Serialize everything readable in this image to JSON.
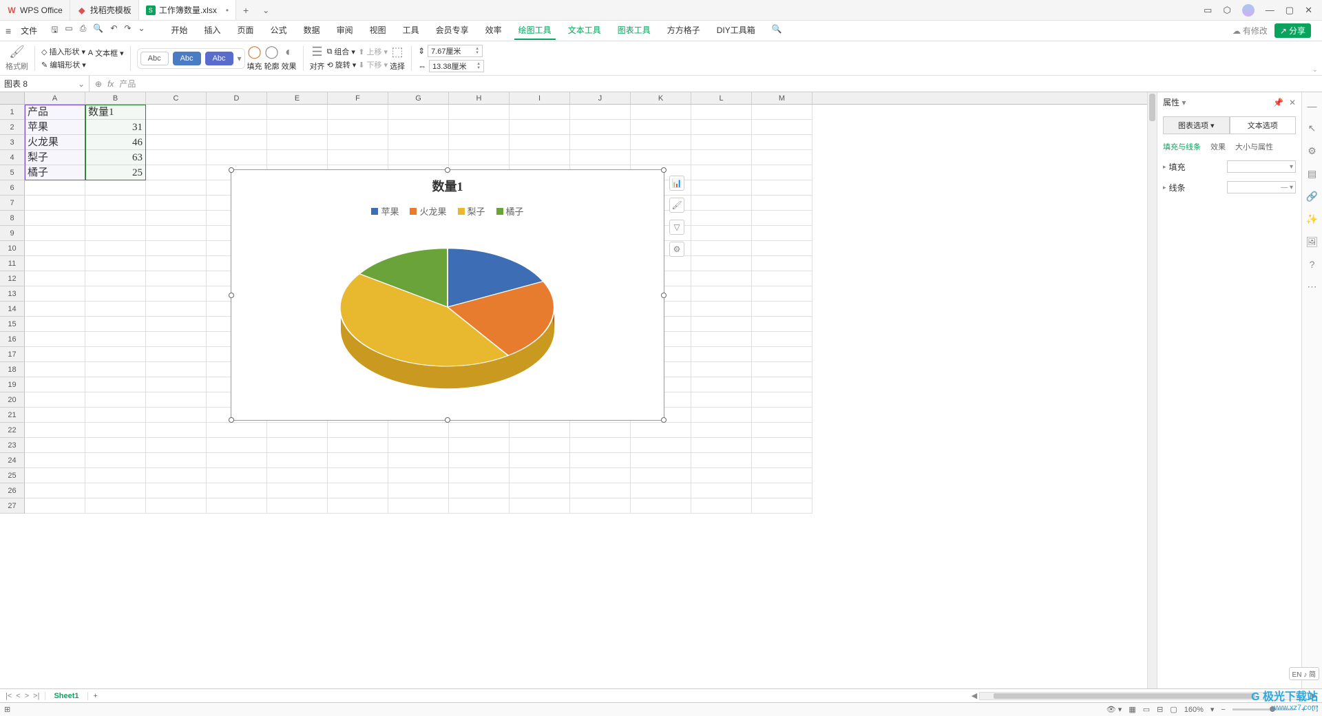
{
  "title_tabs": [
    {
      "icon": "W",
      "label": "WPS Office",
      "active": false
    },
    {
      "icon": "D",
      "label": "找稻壳模板",
      "active": false
    },
    {
      "icon": "S",
      "label": "工作簿数量.xlsx",
      "active": true,
      "dirty": "•"
    }
  ],
  "file_menu": "文件",
  "menu_tabs": [
    "开始",
    "插入",
    "页面",
    "公式",
    "数据",
    "审阅",
    "视图",
    "工具",
    "会员专享",
    "效率"
  ],
  "menu_tabs_green": [
    "绘图工具",
    "文本工具",
    "图表工具",
    "方方格子",
    "DIY工具箱"
  ],
  "menu_active": "绘图工具",
  "modify_label": "有修改",
  "share_label": "分享",
  "ribbon": {
    "format_painter": "格式刷",
    "insert_shape": "插入形状",
    "text_box": "文本框",
    "edit_shape": "编辑形状",
    "abc1": "Abc",
    "abc2": "Abc",
    "abc3": "Abc",
    "fill": "填充",
    "outline": "轮廓",
    "effect": "效果",
    "align": "对齐",
    "group": "组合",
    "rotate": "旋转",
    "up": "上移",
    "down": "下移",
    "select": "选择",
    "w_label": "7.67厘米",
    "h_label": "13.38厘米"
  },
  "name_box": "图表 8",
  "formula": "产品",
  "columns": [
    "A",
    "B",
    "C",
    "D",
    "E",
    "F",
    "G",
    "H",
    "I",
    "J",
    "K",
    "L",
    "M"
  ],
  "row_count": 27,
  "cells": {
    "A1": "产品",
    "B1": "数量1",
    "A2": "苹果",
    "B2": "31",
    "A3": "火龙果",
    "B3": "46",
    "A4": "梨子",
    "B4": "63",
    "A5": "橘子",
    "B5": "25"
  },
  "chart": {
    "title": "数量1",
    "legend": [
      {
        "name": "苹果",
        "color": "#3d6db5"
      },
      {
        "name": "火龙果",
        "color": "#e77c2e"
      },
      {
        "name": "梨子",
        "color": "#e8b92e"
      },
      {
        "name": "橘子",
        "color": "#6aa33a"
      }
    ]
  },
  "chart_data": {
    "type": "pie",
    "title": "数量1",
    "categories": [
      "苹果",
      "火龙果",
      "梨子",
      "橘子"
    ],
    "values": [
      31,
      46,
      63,
      25
    ],
    "colors": [
      "#3d6db5",
      "#e77c2e",
      "#e8b92e",
      "#6aa33a"
    ],
    "three_d": true,
    "legend_position": "top"
  },
  "sheet_tab": "Sheet1",
  "right_panel": {
    "title": "属性",
    "tabs": [
      "图表选项",
      "文本选项"
    ],
    "tab_active": "图表选项",
    "subtabs": [
      "填充与线条",
      "效果",
      "大小与属性"
    ],
    "subtab_active": "填充与线条",
    "fill": "填充",
    "line": "线条"
  },
  "status": {
    "lang": "EN ♪ 简",
    "zoom": "160%"
  },
  "watermark": {
    "logo": "极光下载站",
    "url": "www.xz7.com"
  }
}
